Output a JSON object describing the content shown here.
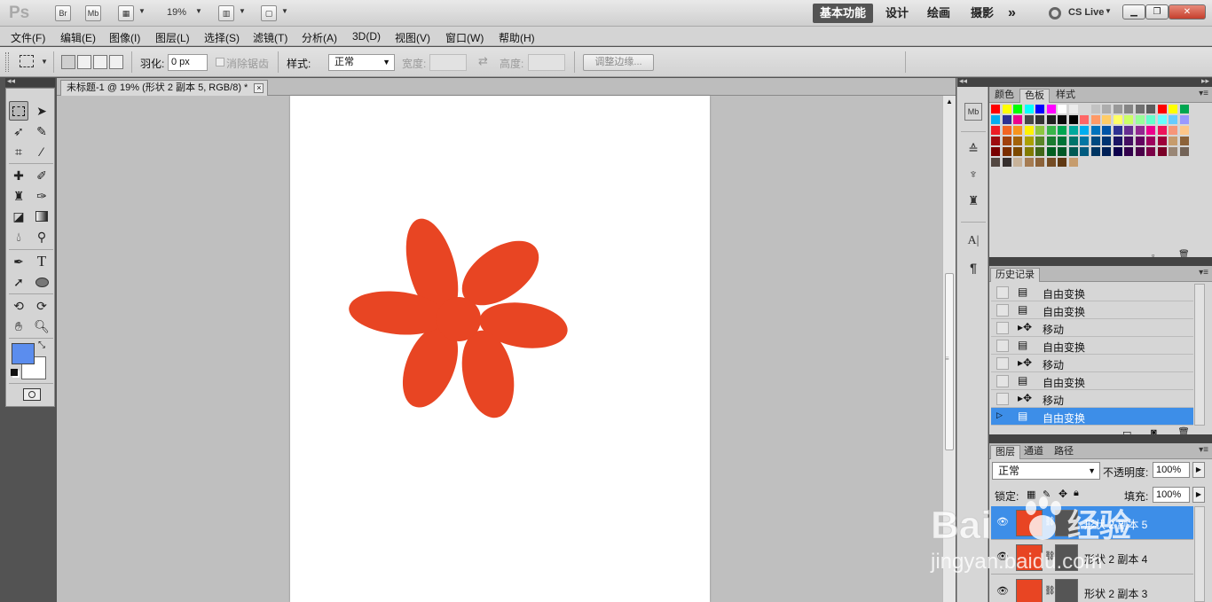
{
  "app": {
    "logo": "Ps",
    "bridge_btn": "Br",
    "minibridge_btn": "Mb",
    "zoom": "19%",
    "workspaces": [
      "基本功能",
      "设计",
      "绘画",
      "摄影"
    ],
    "more": "»",
    "cs_live": "CS Live"
  },
  "menu": [
    "文件(F)",
    "编辑(E)",
    "图像(I)",
    "图层(L)",
    "选择(S)",
    "滤镜(T)",
    "分析(A)",
    "3D(D)",
    "视图(V)",
    "窗口(W)",
    "帮助(H)"
  ],
  "options": {
    "feather_label": "羽化:",
    "feather_value": "0 px",
    "antialias_label": "消除锯齿",
    "style_label": "样式:",
    "style_value": "正常",
    "width_label": "宽度:",
    "height_label": "高度:",
    "refine_edge": "调整边缘..."
  },
  "document": {
    "tab_title": "未标题-1 @ 19% (形状 2 副本 5, RGB/8) *",
    "flower_color": "#e84523"
  },
  "panels": {
    "swatch_tabs": [
      "颜色",
      "色板",
      "样式"
    ],
    "history_title": "历史记录",
    "history_items": [
      {
        "icon": "transform-icon",
        "label": "自由变换"
      },
      {
        "icon": "transform-icon",
        "label": "自由变换"
      },
      {
        "icon": "move-icon",
        "label": "移动"
      },
      {
        "icon": "transform-icon",
        "label": "自由变换"
      },
      {
        "icon": "move-icon",
        "label": "移动"
      },
      {
        "icon": "transform-icon",
        "label": "自由变换"
      },
      {
        "icon": "move-icon",
        "label": "移动"
      },
      {
        "icon": "transform-icon",
        "label": "自由变换",
        "selected": true
      }
    ],
    "layers_tabs": [
      "图层",
      "通道",
      "路径"
    ],
    "blend_mode": "正常",
    "opacity_label": "不透明度:",
    "opacity_value": "100%",
    "lock_label": "锁定:",
    "fill_label": "填充:",
    "fill_value": "100%",
    "layers": [
      {
        "name": "形状 2 副本 5",
        "selected": true
      },
      {
        "name": "形状 2 副本 4",
        "selected": false
      },
      {
        "name": "形状 2 副本 3",
        "selected": false
      }
    ]
  },
  "watermark": {
    "brand": "Bai",
    "product": "经验",
    "url": "jingyan.baidu.com"
  },
  "colors": {
    "foreground": "#5b8dee",
    "background": "#ffffff",
    "selection": "#3d8ee8"
  }
}
